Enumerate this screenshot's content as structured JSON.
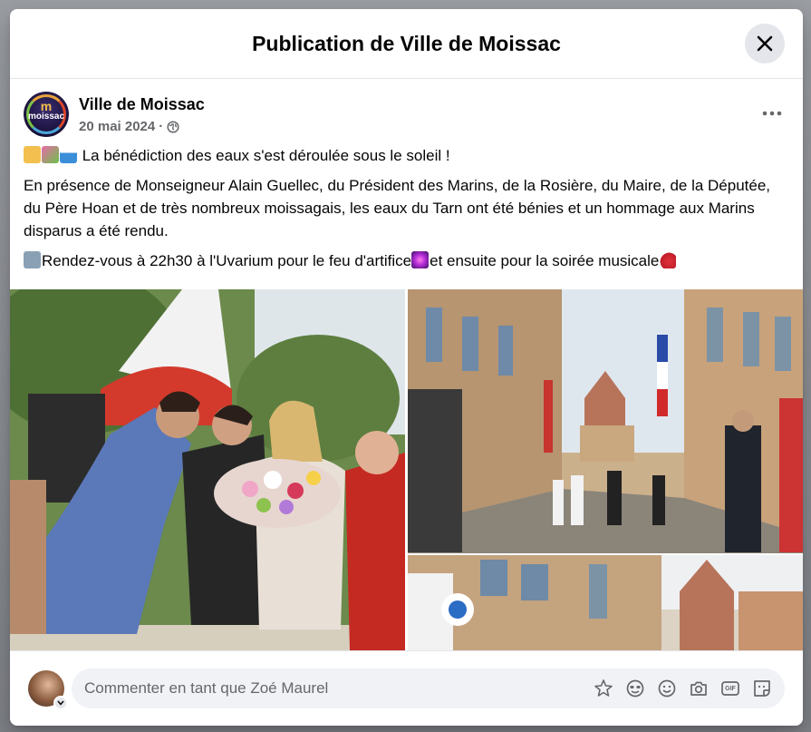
{
  "modal": {
    "title": "Publication de Ville de Moissac"
  },
  "post": {
    "page_name": "Ville de Moissac",
    "date": "20 mai 2024",
    "separator": "·",
    "line1": " La bénédiction des eaux s'est déroulée sous le soleil !",
    "line2": "En présence de Monseigneur Alain Guellec, du Président des Marins, de la Rosière, du Maire, de la Députée, du Père Hoan et de très nombreux moissagais, les eaux du Tarn ont été bénies et un hommage aux Marins disparus a été rendu.",
    "line3a": "Rendez-vous à 22h30 à l'Uvarium pour le feu d'artifice",
    "line3b": "et ensuite pour la soirée musicale",
    "avatar_logo_text": "moissac",
    "avatar_logo_mark": "m"
  },
  "comment": {
    "placeholder": "Commenter en tant que Zoé Maurel",
    "gif_label": "GIF"
  },
  "icons": {
    "close": "close-icon",
    "globe": "globe-icon",
    "more": "more-options-icon",
    "avatar_chevron": "chevron-down-icon",
    "tools": [
      "avatar-sticker-icon",
      "emoji-face-icon",
      "smiley-icon",
      "camera-icon",
      "gif-icon",
      "sticker-icon"
    ]
  },
  "colors": {
    "text_primary": "#050505",
    "text_secondary": "#65676b",
    "divider": "#e4e6eb",
    "input_bg": "#f0f2f5"
  }
}
